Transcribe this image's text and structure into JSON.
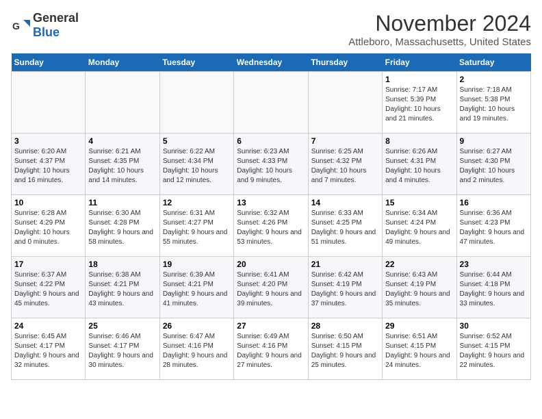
{
  "logo": {
    "general": "General",
    "blue": "Blue"
  },
  "title": "November 2024",
  "subtitle": "Attleboro, Massachusetts, United States",
  "headers": [
    "Sunday",
    "Monday",
    "Tuesday",
    "Wednesday",
    "Thursday",
    "Friday",
    "Saturday"
  ],
  "weeks": [
    [
      {
        "day": "",
        "info": ""
      },
      {
        "day": "",
        "info": ""
      },
      {
        "day": "",
        "info": ""
      },
      {
        "day": "",
        "info": ""
      },
      {
        "day": "",
        "info": ""
      },
      {
        "day": "1",
        "info": "Sunrise: 7:17 AM\nSunset: 5:39 PM\nDaylight: 10 hours and 21 minutes."
      },
      {
        "day": "2",
        "info": "Sunrise: 7:18 AM\nSunset: 5:38 PM\nDaylight: 10 hours and 19 minutes."
      }
    ],
    [
      {
        "day": "3",
        "info": "Sunrise: 6:20 AM\nSunset: 4:37 PM\nDaylight: 10 hours and 16 minutes."
      },
      {
        "day": "4",
        "info": "Sunrise: 6:21 AM\nSunset: 4:35 PM\nDaylight: 10 hours and 14 minutes."
      },
      {
        "day": "5",
        "info": "Sunrise: 6:22 AM\nSunset: 4:34 PM\nDaylight: 10 hours and 12 minutes."
      },
      {
        "day": "6",
        "info": "Sunrise: 6:23 AM\nSunset: 4:33 PM\nDaylight: 10 hours and 9 minutes."
      },
      {
        "day": "7",
        "info": "Sunrise: 6:25 AM\nSunset: 4:32 PM\nDaylight: 10 hours and 7 minutes."
      },
      {
        "day": "8",
        "info": "Sunrise: 6:26 AM\nSunset: 4:31 PM\nDaylight: 10 hours and 4 minutes."
      },
      {
        "day": "9",
        "info": "Sunrise: 6:27 AM\nSunset: 4:30 PM\nDaylight: 10 hours and 2 minutes."
      }
    ],
    [
      {
        "day": "10",
        "info": "Sunrise: 6:28 AM\nSunset: 4:29 PM\nDaylight: 10 hours and 0 minutes."
      },
      {
        "day": "11",
        "info": "Sunrise: 6:30 AM\nSunset: 4:28 PM\nDaylight: 9 hours and 58 minutes."
      },
      {
        "day": "12",
        "info": "Sunrise: 6:31 AM\nSunset: 4:27 PM\nDaylight: 9 hours and 55 minutes."
      },
      {
        "day": "13",
        "info": "Sunrise: 6:32 AM\nSunset: 4:26 PM\nDaylight: 9 hours and 53 minutes."
      },
      {
        "day": "14",
        "info": "Sunrise: 6:33 AM\nSunset: 4:25 PM\nDaylight: 9 hours and 51 minutes."
      },
      {
        "day": "15",
        "info": "Sunrise: 6:34 AM\nSunset: 4:24 PM\nDaylight: 9 hours and 49 minutes."
      },
      {
        "day": "16",
        "info": "Sunrise: 6:36 AM\nSunset: 4:23 PM\nDaylight: 9 hours and 47 minutes."
      }
    ],
    [
      {
        "day": "17",
        "info": "Sunrise: 6:37 AM\nSunset: 4:22 PM\nDaylight: 9 hours and 45 minutes."
      },
      {
        "day": "18",
        "info": "Sunrise: 6:38 AM\nSunset: 4:21 PM\nDaylight: 9 hours and 43 minutes."
      },
      {
        "day": "19",
        "info": "Sunrise: 6:39 AM\nSunset: 4:21 PM\nDaylight: 9 hours and 41 minutes."
      },
      {
        "day": "20",
        "info": "Sunrise: 6:41 AM\nSunset: 4:20 PM\nDaylight: 9 hours and 39 minutes."
      },
      {
        "day": "21",
        "info": "Sunrise: 6:42 AM\nSunset: 4:19 PM\nDaylight: 9 hours and 37 minutes."
      },
      {
        "day": "22",
        "info": "Sunrise: 6:43 AM\nSunset: 4:19 PM\nDaylight: 9 hours and 35 minutes."
      },
      {
        "day": "23",
        "info": "Sunrise: 6:44 AM\nSunset: 4:18 PM\nDaylight: 9 hours and 33 minutes."
      }
    ],
    [
      {
        "day": "24",
        "info": "Sunrise: 6:45 AM\nSunset: 4:17 PM\nDaylight: 9 hours and 32 minutes."
      },
      {
        "day": "25",
        "info": "Sunrise: 6:46 AM\nSunset: 4:17 PM\nDaylight: 9 hours and 30 minutes."
      },
      {
        "day": "26",
        "info": "Sunrise: 6:47 AM\nSunset: 4:16 PM\nDaylight: 9 hours and 28 minutes."
      },
      {
        "day": "27",
        "info": "Sunrise: 6:49 AM\nSunset: 4:16 PM\nDaylight: 9 hours and 27 minutes."
      },
      {
        "day": "28",
        "info": "Sunrise: 6:50 AM\nSunset: 4:15 PM\nDaylight: 9 hours and 25 minutes."
      },
      {
        "day": "29",
        "info": "Sunrise: 6:51 AM\nSunset: 4:15 PM\nDaylight: 9 hours and 24 minutes."
      },
      {
        "day": "30",
        "info": "Sunrise: 6:52 AM\nSunset: 4:15 PM\nDaylight: 9 hours and 22 minutes."
      }
    ]
  ]
}
